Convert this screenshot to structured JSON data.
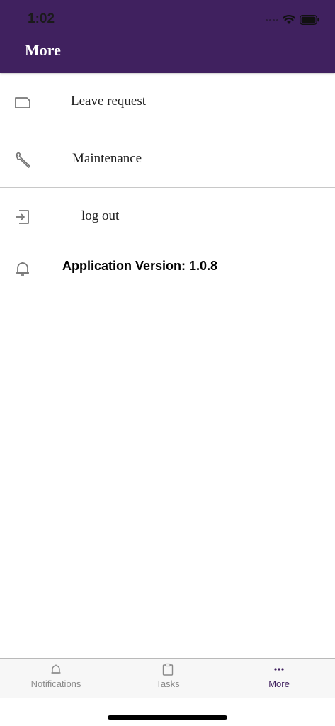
{
  "status_bar": {
    "time": "1:02"
  },
  "header": {
    "title": "More"
  },
  "menu": {
    "items": [
      {
        "label": "Leave request",
        "icon": "document-icon"
      },
      {
        "label": "Maintenance",
        "icon": "wrench-icon"
      },
      {
        "label": "log out",
        "icon": "logout-icon"
      }
    ],
    "version_label": "Application Version: 1.0.8"
  },
  "tabbar": {
    "tabs": [
      {
        "label": "Notifications",
        "icon": "bell-icon",
        "active": false
      },
      {
        "label": "Tasks",
        "icon": "clipboard-icon",
        "active": false
      },
      {
        "label": "More",
        "icon": "more-dots-icon",
        "active": true
      }
    ]
  },
  "colors": {
    "header": "#40215f",
    "accent": "#40215f",
    "tab_inactive": "#8a8a8a",
    "divider": "#c8c8c8"
  }
}
